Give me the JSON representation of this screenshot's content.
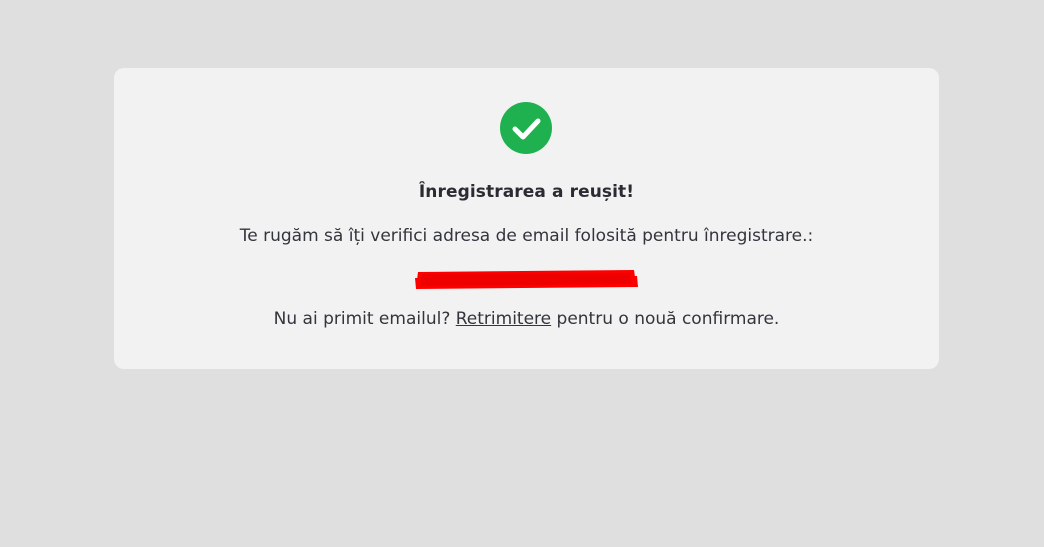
{
  "status": {
    "icon": "check-circle-icon",
    "icon_color": "#1fb14f",
    "title": "Înregistrarea a reușit!",
    "message": "Te rugăm să îți verifici adresa de email folosită pentru înregistrare.:"
  },
  "email": {
    "value": "",
    "redaction_color": "#ff0000"
  },
  "resend": {
    "prefix": "Nu ai primit emailul?",
    "link_label": "Retrimitere",
    "suffix": "pentru o nouă confirmare."
  }
}
